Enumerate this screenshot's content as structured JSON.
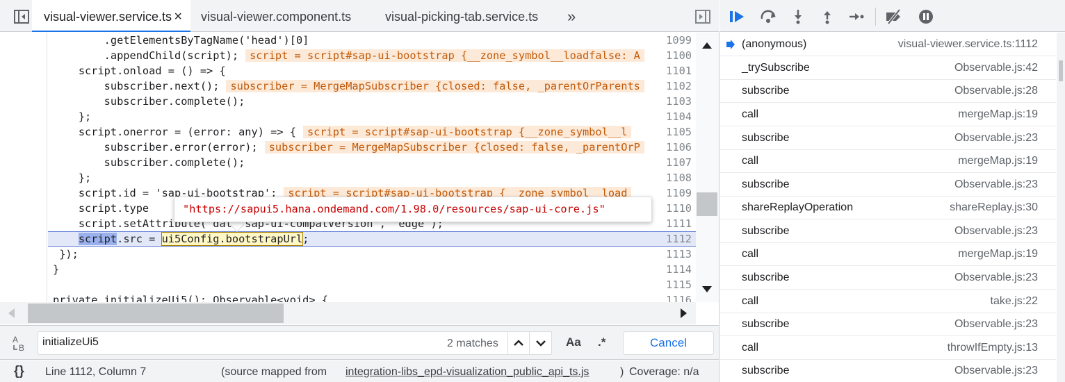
{
  "tabs": [
    {
      "label": "visual-viewer.service.ts",
      "active": true,
      "close": "×"
    },
    {
      "label": "visual-viewer.component.ts",
      "active": false
    },
    {
      "label": "visual-picking-tab.service.ts",
      "active": false
    }
  ],
  "tab_overflow": "»",
  "code_lines": [
    {
      "num": "1099",
      "text": "    .getElementsByTagName('head')[0]"
    },
    {
      "num": "1100",
      "text": "    .appendChild(script);",
      "inline": "script = script#sap-ui-bootstrap {__zone_symbol__loadfalse: A"
    },
    {
      "num": "1101",
      "text": "  script.onload = () => {"
    },
    {
      "num": "1102",
      "text": "    subscriber.next();",
      "inline": "subscriber = MergeMapSubscriber {closed: false, _parentOrParents"
    },
    {
      "num": "1103",
      "text": "    subscriber.complete();"
    },
    {
      "num": "1104",
      "text": "  };"
    },
    {
      "num": "1105",
      "text": "  script.onerror = (error: any) => {",
      "inline": "script = script#sap-ui-bootstrap {__zone_symbol__l"
    },
    {
      "num": "1106",
      "text": "    subscriber.error(error);",
      "inline": "subscriber = MergeMapSubscriber {closed: false, _parentOrP"
    },
    {
      "num": "1107",
      "text": "    subscriber.complete();"
    },
    {
      "num": "1108",
      "text": "  };"
    },
    {
      "num": "1109",
      "text": "  script.id = 'sap-ui-bootstrap';",
      "inline": "script = script#sap-ui-bootstrap {__zone_symbol__load"
    },
    {
      "num": "1110",
      "text": "  script.type"
    },
    {
      "num": "1111",
      "text": "  script.setAttribute('data-sap-ui-compatVersion', 'edge');"
    },
    {
      "num": "1112",
      "text": "  script.src = ui5Config.bootstrapUrl;"
    },
    {
      "num": "1113",
      "text": " });"
    },
    {
      "num": "1114",
      "text": "}"
    },
    {
      "num": "1115",
      "text": ""
    },
    {
      "num": "1116",
      "text": "private initializeUi5(): Observable<void> {"
    }
  ],
  "tooltip": "\"https://sapui5.hana.ondemand.com/1.98.0/resources/sap-ui-core.js\"",
  "search": {
    "value": "initializeUi5",
    "match_count": "2 matches",
    "case_label": "Aa",
    "regex_label": ".*",
    "cancel_label": "Cancel"
  },
  "status": {
    "braces": "{}",
    "position": "Line 1112, Column 7",
    "source_prefix": "(source mapped from",
    "source_file": "integration-libs_epd-visualization_public_api_ts.js",
    "source_suffix": ")",
    "coverage": "Coverage: n/a"
  },
  "call_stack": [
    {
      "fn": "(anonymous)",
      "loc": "visual-viewer.service.ts:1112",
      "current": true
    },
    {
      "fn": "_trySubscribe",
      "loc": "Observable.js:42"
    },
    {
      "fn": "subscribe",
      "loc": "Observable.js:28"
    },
    {
      "fn": "call",
      "loc": "mergeMap.js:19"
    },
    {
      "fn": "subscribe",
      "loc": "Observable.js:23"
    },
    {
      "fn": "call",
      "loc": "mergeMap.js:19"
    },
    {
      "fn": "subscribe",
      "loc": "Observable.js:23"
    },
    {
      "fn": "shareReplayOperation",
      "loc": "shareReplay.js:30"
    },
    {
      "fn": "subscribe",
      "loc": "Observable.js:23"
    },
    {
      "fn": "call",
      "loc": "mergeMap.js:19"
    },
    {
      "fn": "subscribe",
      "loc": "Observable.js:23"
    },
    {
      "fn": "call",
      "loc": "take.js:22"
    },
    {
      "fn": "subscribe",
      "loc": "Observable.js:23"
    },
    {
      "fn": "call",
      "loc": "throwIfEmpty.js:13"
    },
    {
      "fn": "subscribe",
      "loc": "Observable.js:23"
    }
  ],
  "colors": {
    "accent": "#1a73e8",
    "inline_value_bg": "#fde9d7",
    "exec_line_bg": "#e3e8f8"
  }
}
